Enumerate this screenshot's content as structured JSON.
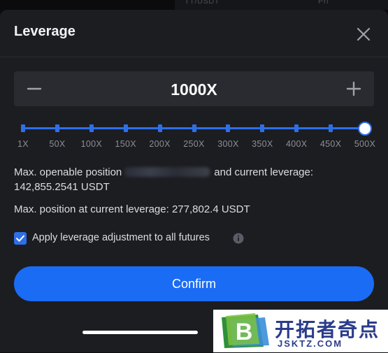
{
  "background": {
    "left_text": "TT/USDT",
    "right_text": "Pri"
  },
  "modal": {
    "title": "Leverage"
  },
  "stepper": {
    "value": "1000X"
  },
  "slider": {
    "labels": [
      "1X",
      "50X",
      "100X",
      "150X",
      "200X",
      "250X",
      "300X",
      "350X",
      "400X",
      "450X",
      "500X"
    ],
    "level": 1.0
  },
  "info": {
    "openable_prefix": "Max. openable position",
    "openable_suffix": "and current leverage:",
    "openable_value": "142,855.2541 USDT",
    "max_position": "Max. position at current leverage: 277,802.4 USDT"
  },
  "apply": {
    "label": "Apply leverage adjustment to all futures",
    "checked": true
  },
  "confirm": {
    "label": "Confirm"
  },
  "watermark": {
    "title": "开拓者奇点",
    "url": "JSKTZ.COM",
    "logo_letter": "B"
  },
  "colors": {
    "accent": "#1a6cf5",
    "modal_bg": "#1c1d21",
    "stepper_bg": "#2a2b30"
  }
}
